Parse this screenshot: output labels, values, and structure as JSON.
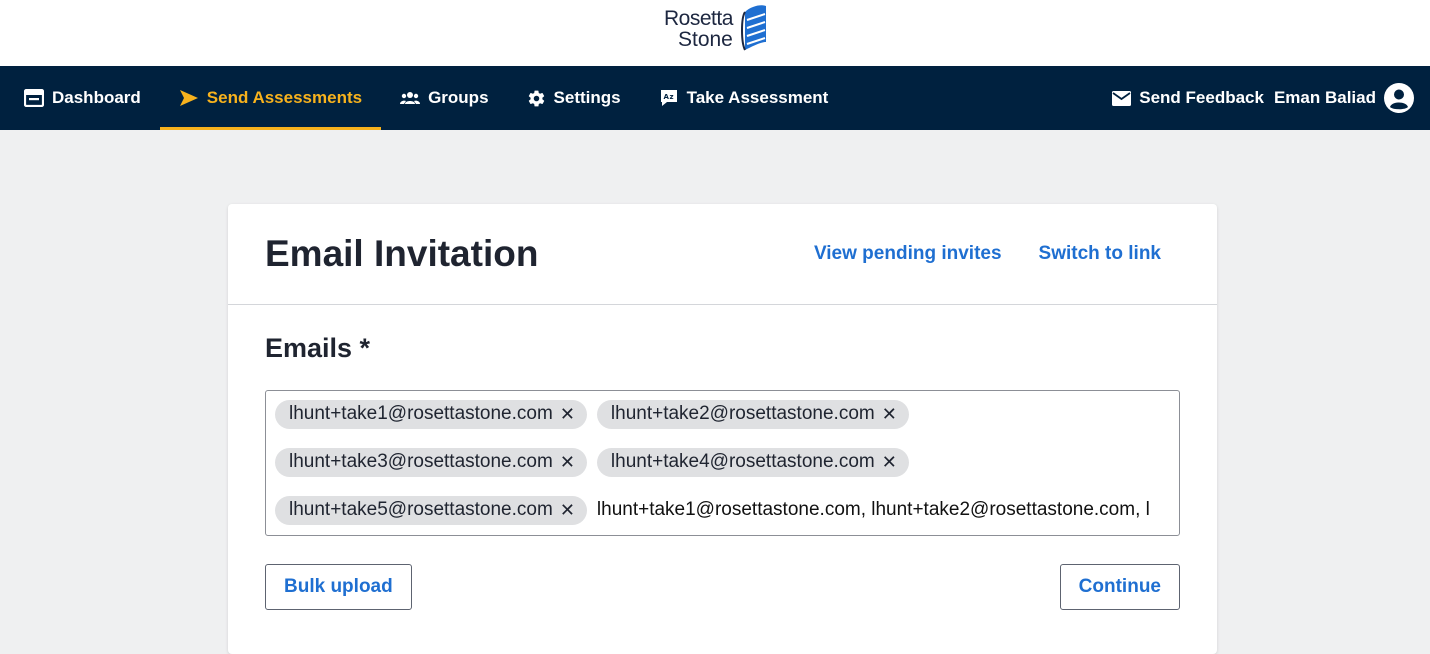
{
  "brand": {
    "logo_line1": "Rosetta",
    "logo_line2": "Stone",
    "logo_color": "#1f6fd1"
  },
  "nav": {
    "items": [
      {
        "label": "Dashboard",
        "icon": "dashboard-icon"
      },
      {
        "label": "Send Assessments",
        "icon": "send-icon",
        "active": true
      },
      {
        "label": "Groups",
        "icon": "groups-icon"
      },
      {
        "label": "Settings",
        "icon": "gear-icon"
      },
      {
        "label": "Take Assessment",
        "icon": "translate-chat-icon"
      }
    ],
    "feedback_label": "Send Feedback",
    "user_name": "Eman Baliad",
    "active_color": "#f7b21d",
    "background": "#00213f"
  },
  "card": {
    "title": "Email Invitation",
    "view_pending_label": "View pending invites",
    "switch_link_label": "Switch to link",
    "emails_label": "Emails *",
    "chips": [
      "lhunt+take1@rosettastone.com",
      "lhunt+take2@rosettastone.com",
      "lhunt+take3@rosettastone.com",
      "lhunt+take4@rosettastone.com",
      "lhunt+take5@rosettastone.com"
    ],
    "input_value": "lhunt+take1@rosettastone.com, lhunt+take2@rosettastone.com, l",
    "bulk_upload_label": "Bulk upload",
    "continue_label": "Continue"
  }
}
